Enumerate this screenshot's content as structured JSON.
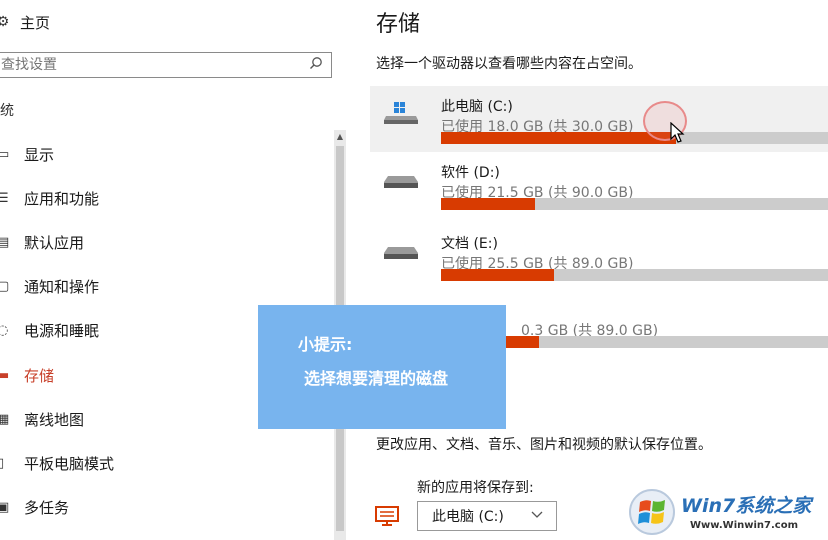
{
  "sidebar": {
    "home_label": "主页",
    "search_placeholder": "查找设置",
    "section_header": "统",
    "items": [
      {
        "label": "显示",
        "icon": "display-icon",
        "active": false
      },
      {
        "label": "应用和功能",
        "icon": "apps-features-icon",
        "active": false
      },
      {
        "label": "默认应用",
        "icon": "default-apps-icon",
        "active": false
      },
      {
        "label": "通知和操作",
        "icon": "notifications-icon",
        "active": false
      },
      {
        "label": "电源和睡眠",
        "icon": "power-icon",
        "active": false
      },
      {
        "label": "存储",
        "icon": "storage-icon",
        "active": true
      },
      {
        "label": "离线地图",
        "icon": "offline-maps-icon",
        "active": false
      },
      {
        "label": "平板电脑模式",
        "icon": "tablet-mode-icon",
        "active": false
      },
      {
        "label": "多任务",
        "icon": "multitasking-icon",
        "active": false
      }
    ]
  },
  "main": {
    "title": "存储",
    "subtitle": "选择一个驱动器以查看哪些内容在占空间。",
    "drives": [
      {
        "name": "此电脑 (C:)",
        "usage": "已使用 18.0 GB (共 30.0 GB)",
        "used_fraction": 0.6,
        "selected": true,
        "system": true
      },
      {
        "name": "软件 (D:)",
        "usage": "已使用 21.5 GB (共 90.0 GB)",
        "used_fraction": 0.239,
        "selected": false,
        "system": false
      },
      {
        "name": "文档 (E:)",
        "usage": "已使用 25.5 GB (共 89.0 GB)",
        "used_fraction": 0.287,
        "selected": false,
        "system": false
      },
      {
        "name": "",
        "usage": "0.3 GB (共 89.0 GB)",
        "used_fraction": 0.25,
        "selected": false,
        "system": false
      }
    ],
    "change_text": "更改应用、文档、音乐、图片和视频的默认保存位置。",
    "new_apps_label": "新的应用将保存到:",
    "new_apps_value": "此电脑 (C:)"
  },
  "tip": {
    "title": "小提示:",
    "body": "选择想要清理的磁盘"
  },
  "watermark": {
    "brand": "Win7系统之家",
    "url": "Www.Winwin7.com"
  },
  "colors": {
    "accent": "#d83b01",
    "active_nav": "#c8402a",
    "bar_track": "#cccccc",
    "tip_bg": "#78b4ee",
    "selected_bg": "#f0f0f0"
  }
}
